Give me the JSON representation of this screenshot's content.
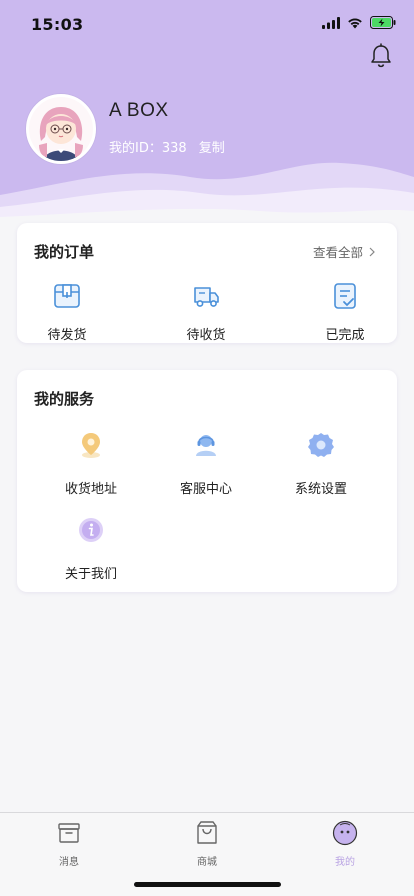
{
  "status_bar": {
    "time": "15:03"
  },
  "profile": {
    "name": "A BOX",
    "id_label": "我的ID：",
    "id_value": "338",
    "copy_label": "复制"
  },
  "orders": {
    "title": "我的订单",
    "view_all": "查看全部",
    "items": [
      {
        "label": "待发货",
        "icon": "box-icon"
      },
      {
        "label": "待收货",
        "icon": "truck-icon"
      },
      {
        "label": "已完成",
        "icon": "checklist-icon"
      }
    ]
  },
  "services": {
    "title": "我的服务",
    "items": [
      {
        "label": "收货地址",
        "icon": "location-pin-icon"
      },
      {
        "label": "客服中心",
        "icon": "customer-service-icon"
      },
      {
        "label": "系统设置",
        "icon": "gear-icon"
      },
      {
        "label": "关于我们",
        "icon": "info-icon"
      }
    ]
  },
  "tabbar": {
    "items": [
      {
        "label": "消息",
        "icon": "inbox-icon",
        "active": false
      },
      {
        "label": "商城",
        "icon": "shopping-bag-icon",
        "active": false
      },
      {
        "label": "我的",
        "icon": "profile-face-icon",
        "active": true
      }
    ]
  },
  "colors": {
    "header_bg": "#cbb9ef",
    "accent": "#b9a3e3",
    "icon_blue": "#4a90d9"
  }
}
